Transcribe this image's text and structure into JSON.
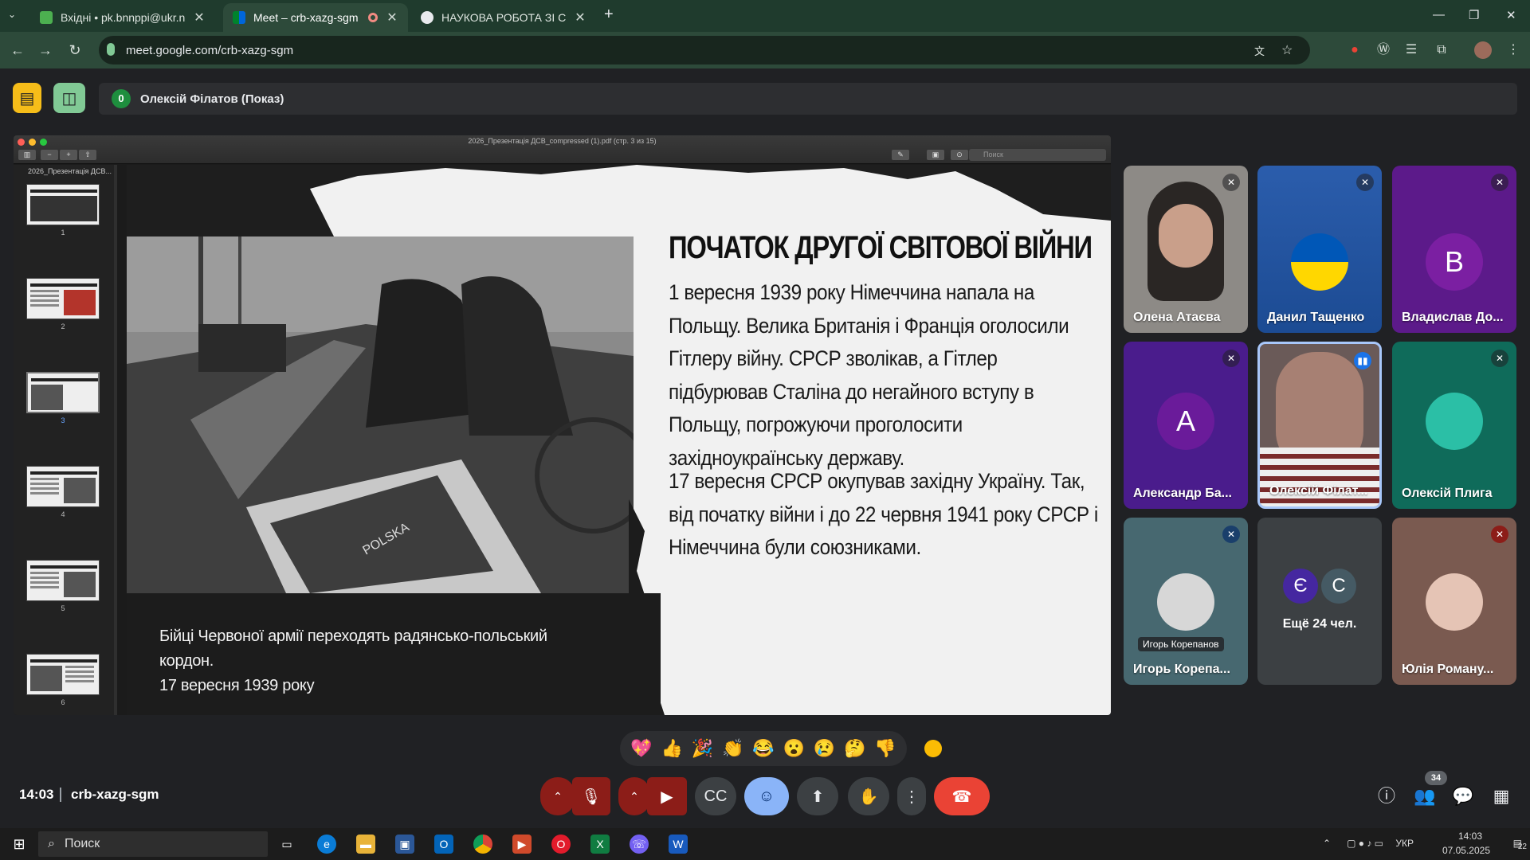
{
  "browser": {
    "tabs": [
      {
        "title": "Вхідні • pk.bnnppi@ukr.net",
        "active": false
      },
      {
        "title": "Meet – crb-xazg-sgm",
        "active": true
      },
      {
        "title": "НАУКОВА РОБОТА ЗІ СТУДЕНТ",
        "active": false
      }
    ],
    "new_tab": "+",
    "url": "meet.google.com/crb-xazg-sgm"
  },
  "meet": {
    "presenter_count": "0",
    "presenter_label": "Олексій Філатов (Показ)",
    "time": "14:03",
    "meeting_code": "crb-xazg-sgm",
    "people_count": "34"
  },
  "pdf": {
    "window_title": "2026_Презентація ДСВ_compressed (1).pdf (стр. 3 из 15)",
    "search_placeholder": "Поиск",
    "sidebar_header": "2026_Презентація ДСВ...",
    "thumb_labels": [
      "1",
      "2",
      "3",
      "4",
      "5",
      "6"
    ]
  },
  "slide": {
    "title": "ПОЧАТОК ДРУГОЇ СВІТОВОЇ ВІЙНИ",
    "paragraph1": "1 вересня 1939 року Німеччина напала на Польщу. Велика Британія і Франція оголосили Гітлеру війну. СРСР зволікав, а Гітлер підбурював Сталіна до негайного вступу в Польщу, погрожуючи проголосити західноукраїнську державу.",
    "paragraph2": "17 вересня СРСР окупував західну Україну. Так, від початку війни і до 22 червня 1941 року СРСР і Німеччина були союзниками.",
    "caption_line1": "Бійці Червоної армії переходять радянсько-польський кордон.",
    "caption_line2": "17 вересня 1939 року",
    "photo_text": "POLSKA"
  },
  "participants": [
    {
      "name": "Олена Атаєва",
      "type": "video"
    },
    {
      "name": "Данил Тащенко",
      "type": "avatar"
    },
    {
      "name": "Владислав До...",
      "type": "letter",
      "letter": "В",
      "color": "#7b1fa2"
    },
    {
      "name": "Александр Ба...",
      "type": "letter",
      "letter": "А",
      "color": "#6a1b9a"
    },
    {
      "name": "Олексій Філат...",
      "type": "video"
    },
    {
      "name": "Олексій Плига",
      "type": "avatar"
    },
    {
      "name": "Игорь Корепа...",
      "type": "avatar",
      "tooltip": "Игорь Корепанов"
    },
    {
      "name": "Ещё 24 чел.",
      "type": "more",
      "letters": [
        "Є",
        "С"
      ]
    },
    {
      "name": "Юлія Роману...",
      "type": "avatar"
    }
  ],
  "reactions": [
    "💖",
    "👍",
    "🎉",
    "👏",
    "😂",
    "😮",
    "😢",
    "🤔",
    "👎"
  ],
  "taskbar": {
    "search_label": "Поиск",
    "lang": "УКР",
    "clock_time": "14:03",
    "clock_date": "07.05.2025",
    "notif_count": "22"
  },
  "colors": {
    "accent_red": "#ea4335",
    "active_reaction": "#8ab4f8",
    "meet_bg": "#202124"
  }
}
